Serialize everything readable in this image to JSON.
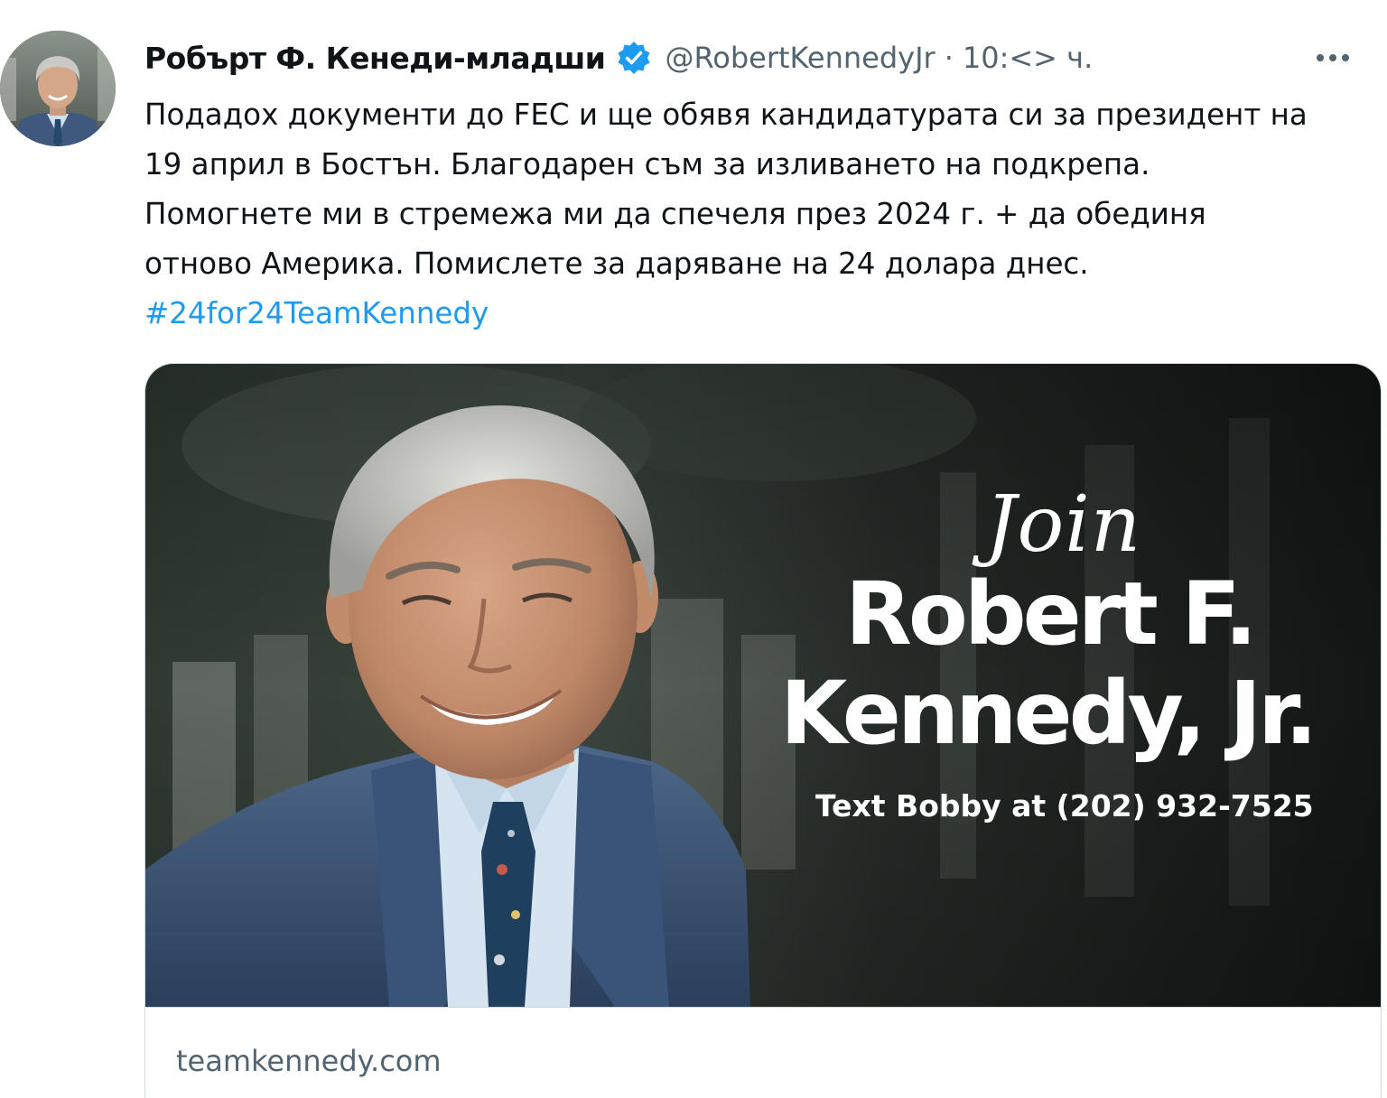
{
  "tweet": {
    "author": {
      "name": "Робърт Ф. Кенеди-младши",
      "handle": "@RobertKennedyJr",
      "separator": "·",
      "time": "10:<> ч.",
      "verified": true,
      "avatar_icon": "profile-photo"
    },
    "more_icon": "more-horizontal-icon",
    "text_lines": [
      "Подадох документи до FEC и ще обявя кандидатурата си за президент на",
      "19 април в Бостън. Благодарен съм за изливането на подкрепа.",
      "Помогнете ми в стремежа ми да спечеля през 2024 г. + да обединя",
      "отново Америка. Помислете за даряване на 24 долара днес."
    ],
    "hashtag": "#24for24TeamKennedy",
    "card": {
      "image_text": {
        "join": "Join",
        "name_line1": "Robert F.",
        "name_line2": "Kennedy, Jr.",
        "cta": "Text Bobby at (202) 932-7525"
      },
      "domain": "teamkennedy.com"
    }
  },
  "colors": {
    "text": "#0f1419",
    "secondary": "#536471",
    "link": "#1d9bf0",
    "border": "#cfd9de",
    "verified": "#1d9bf0"
  }
}
